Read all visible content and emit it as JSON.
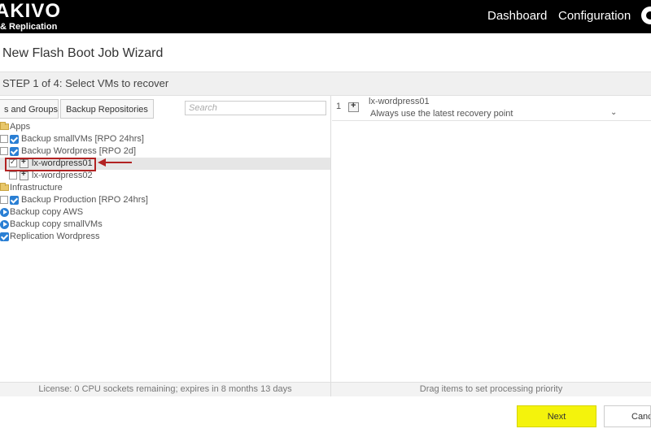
{
  "header": {
    "logo_main": "AKIVO",
    "logo_sub": "& Replication",
    "nav": [
      {
        "label": "Dashboard"
      },
      {
        "label": "Configuration"
      }
    ]
  },
  "wizard": {
    "title": "New Flash Boot Job Wizard",
    "step": "STEP 1 of 4: Select VMs to recover"
  },
  "left": {
    "tabs": [
      {
        "label": "s and Groups"
      },
      {
        "label": "Backup Repositories"
      }
    ],
    "search_placeholder": "Search",
    "tree": [
      {
        "label": "Apps"
      },
      {
        "label": "Backup smallVMs [RPO 24hrs]"
      },
      {
        "label": "Backup Wordpress [RPO 2d]"
      },
      {
        "label": "lx-wordpress01"
      },
      {
        "label": "lx-wordpress02"
      },
      {
        "label": "Infrastructure"
      },
      {
        "label": "Backup Production [RPO 24hrs]"
      },
      {
        "label": "Backup copy AWS"
      },
      {
        "label": "Backup copy smallVMs"
      },
      {
        "label": "Replication Wordpress"
      }
    ],
    "status": "License: 0 CPU sockets remaining; expires in 8 months 13 days"
  },
  "right": {
    "item": {
      "index": "1",
      "name": "lx-wordpress01",
      "recovery_option": "Always use the latest recovery point"
    },
    "status": "Drag items to set processing priority"
  },
  "footer": {
    "next_label": "Next",
    "cancel_label": "Cancel"
  },
  "colors": {
    "topbar": "#000000",
    "next_button": "#f4f30c",
    "check_blue": "#2a7fd4",
    "highlight_red": "#b22222"
  }
}
